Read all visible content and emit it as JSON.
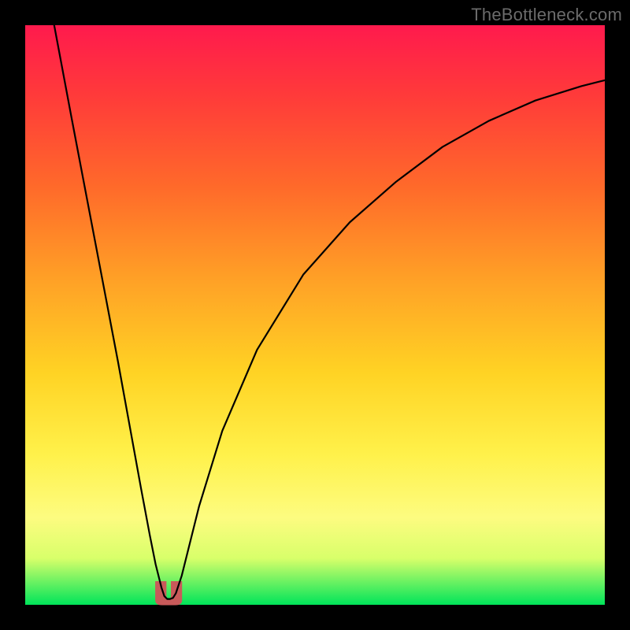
{
  "watermark": "TheBottleneck.com",
  "chart_data": {
    "type": "line",
    "title": "",
    "xlabel": "",
    "ylabel": "",
    "xlim": [
      0,
      100
    ],
    "ylim": [
      0,
      100
    ],
    "grid": false,
    "legend": false,
    "series": [
      {
        "name": "bottleneck-curve",
        "x": [
          5,
          8,
          12,
          16,
          18,
          20,
          21.5,
          22.5,
          23.5,
          24,
          24.5,
          25,
          25.5,
          26,
          27,
          28,
          30,
          34,
          40,
          48,
          56,
          64,
          72,
          80,
          88,
          96,
          100
        ],
        "y": [
          100,
          84,
          63,
          42,
          31,
          20,
          12,
          7,
          3,
          1.5,
          1,
          1,
          1.2,
          2,
          5,
          9,
          17,
          30,
          44,
          57,
          66,
          73,
          79,
          83.5,
          87,
          89.5,
          90.5
        ]
      }
    ],
    "annotations": [
      {
        "name": "trough-marker",
        "shape": "u-blob",
        "color": "#c85a5a",
        "x_range": [
          22.5,
          27
        ],
        "y_range": [
          0,
          4
        ]
      }
    ]
  }
}
